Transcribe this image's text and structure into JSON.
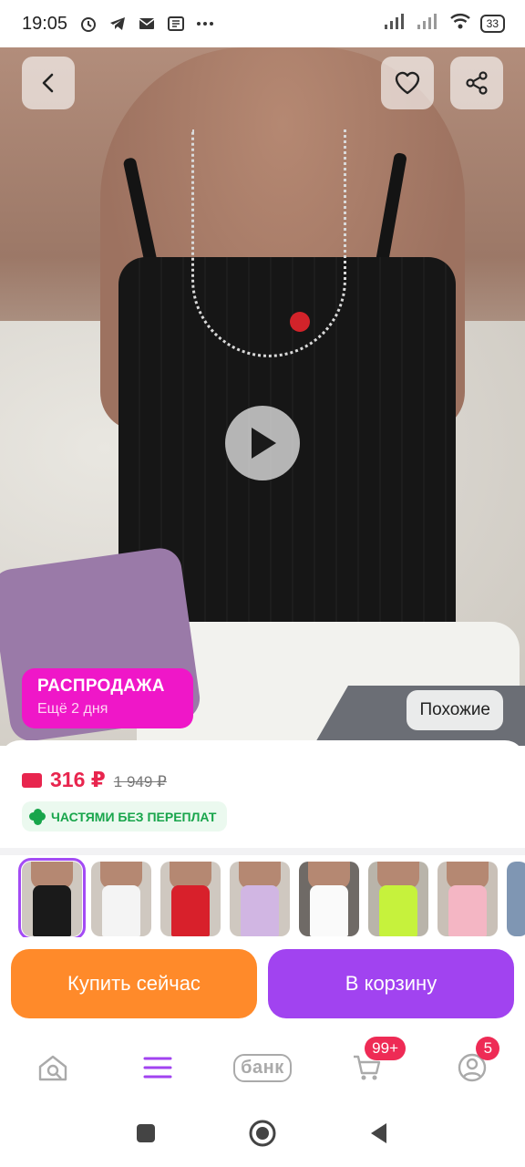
{
  "status_bar": {
    "time": "19:05",
    "battery": "33",
    "icons": [
      "alarm-icon",
      "telegram-icon",
      "mail-icon",
      "news-icon",
      "more-icon"
    ]
  },
  "product": {
    "sale_badge": {
      "title": "РАСПРОДАЖА",
      "subtitle": "Ещё 2 дня"
    },
    "similar_label": "Похожие",
    "price": "316 ₽",
    "old_price": "1 949 ₽",
    "installment": "ЧАСТЯМИ БЕЗ ПЕРЕПЛАТ",
    "thumbnail_colors": [
      "black",
      "white",
      "red",
      "lilac",
      "white",
      "lime",
      "pink",
      "blue"
    ],
    "selected_thumbnail": 0
  },
  "actions": {
    "buy_now": "Купить сейчас",
    "add_to_cart": "В корзину"
  },
  "bottom_nav": {
    "bank_label": "банк",
    "cart_badge": "99+",
    "profile_badge": "5"
  },
  "colors": {
    "accent_purple": "#a143f0",
    "buy_orange": "#ff8a2a",
    "price_red": "#e8254e",
    "sale_pink": "#ef17c8",
    "installment_green": "#18a54b"
  }
}
